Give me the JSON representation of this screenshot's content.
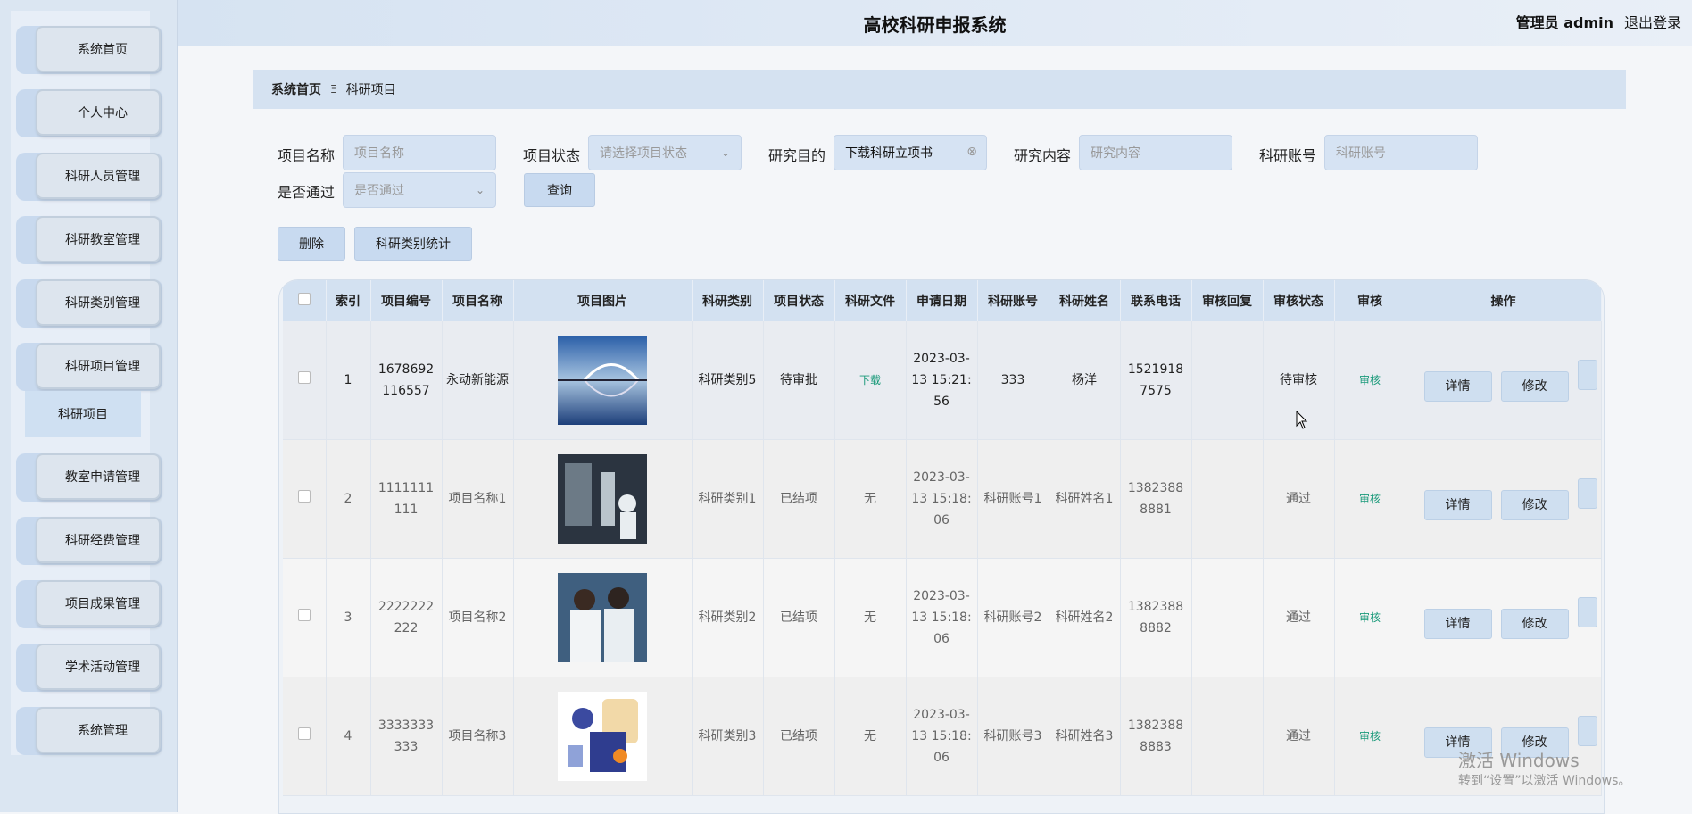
{
  "app": {
    "title": "高校科研申报系统",
    "admin": "管理员 admin",
    "logout": "退出登录"
  },
  "sidebar": {
    "items": [
      {
        "label": "系统首页"
      },
      {
        "label": "个人中心"
      },
      {
        "label": "科研人员管理"
      },
      {
        "label": "科研教室管理"
      },
      {
        "label": "科研类别管理"
      },
      {
        "label": "科研项目管理"
      },
      {
        "label": "教室申请管理"
      },
      {
        "label": "科研经费管理"
      },
      {
        "label": "项目成果管理"
      },
      {
        "label": "学术活动管理"
      },
      {
        "label": "系统管理"
      }
    ],
    "subitem": "科研项目"
  },
  "breadcrumb": {
    "home": "系统首页",
    "sep": "Ξ",
    "current": "科研项目"
  },
  "search": {
    "project_name_label": "项目名称",
    "project_name_ph": "项目名称",
    "status_label": "项目状态",
    "status_ph": "请选择项目状态",
    "purpose_label": "研究目的",
    "purpose_value": "下载科研立项书",
    "content_label": "研究内容",
    "content_ph": "研究内容",
    "account_label": "科研账号",
    "account_ph": "科研账号",
    "passed_label": "是否通过",
    "passed_ph": "是否通过",
    "query_btn": "查询"
  },
  "toolbar": {
    "delete": "删除",
    "stats": "科研类别统计"
  },
  "table": {
    "headers": [
      "索引",
      "项目编号",
      "项目名称",
      "项目图片",
      "科研类别",
      "项目状态",
      "科研文件",
      "申请日期",
      "科研账号",
      "科研姓名",
      "联系电话",
      "审核回复",
      "审核状态",
      "审核",
      "操作"
    ],
    "rows": [
      {
        "idx": "1",
        "no": "1678692116557",
        "name": "永动新能源",
        "cat": "科研类别5",
        "status": "待审批",
        "file": "下载",
        "date": "2023-03-13 15:21:56",
        "account": "333",
        "person": "杨洋",
        "phone": "15219187575",
        "reply": "",
        "audit_status": "待审核",
        "audit": "审核",
        "detail": "详情",
        "edit": "修改"
      },
      {
        "idx": "2",
        "no": "1111111111",
        "name": "项目名称1",
        "cat": "科研类别1",
        "status": "已结项",
        "file": "无",
        "date": "2023-03-13 15:18:06",
        "account": "科研账号1",
        "person": "科研姓名1",
        "phone": "13823888881",
        "reply": "",
        "audit_status": "通过",
        "audit": "审核",
        "detail": "详情",
        "edit": "修改"
      },
      {
        "idx": "3",
        "no": "2222222222",
        "name": "项目名称2",
        "cat": "科研类别2",
        "status": "已结项",
        "file": "无",
        "date": "2023-03-13 15:18:06",
        "account": "科研账号2",
        "person": "科研姓名2",
        "phone": "13823888882",
        "reply": "",
        "audit_status": "通过",
        "audit": "审核",
        "detail": "详情",
        "edit": "修改"
      },
      {
        "idx": "4",
        "no": "3333333333",
        "name": "项目名称3",
        "cat": "科研类别3",
        "status": "已结项",
        "file": "无",
        "date": "2023-03-13 15:18:06",
        "account": "科研账号3",
        "person": "科研姓名3",
        "phone": "13823888883",
        "reply": "",
        "audit_status": "通过",
        "audit": "审核",
        "detail": "详情",
        "edit": "修改"
      }
    ]
  },
  "watermark": {
    "line1": "激活 Windows",
    "line2": "转到“设置”以激活 Windows。"
  },
  "colors": {
    "accent": "#c8daf0",
    "link": "#1a9a7a"
  }
}
